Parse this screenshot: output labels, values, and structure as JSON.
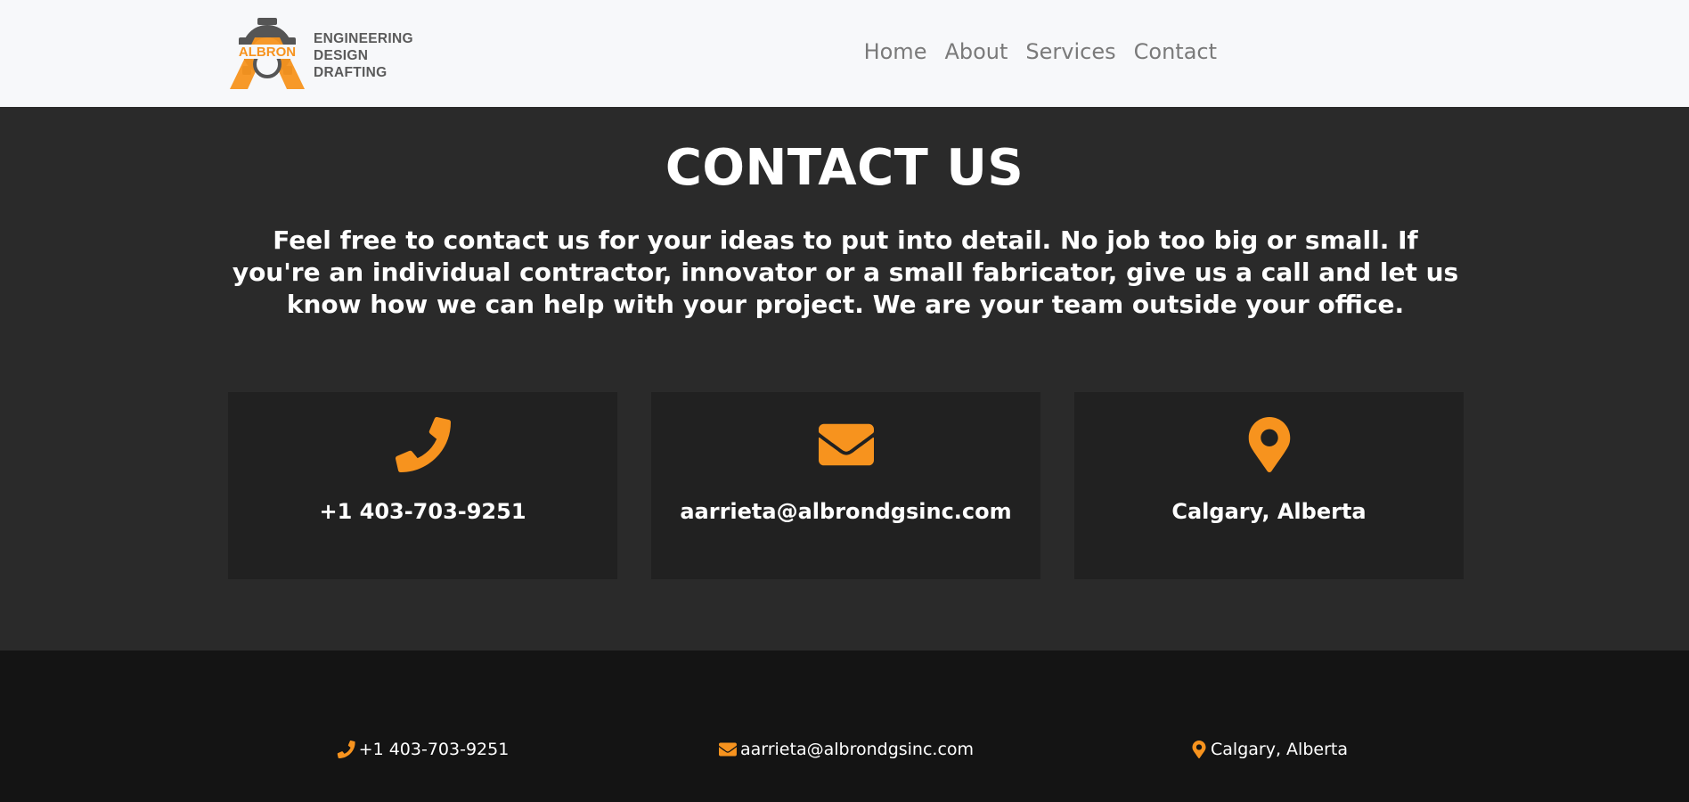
{
  "brand": {
    "logo_text": "ALBRON",
    "tagline_lines": [
      "ENGINEERING",
      "DESIGN",
      "DRAFTING"
    ],
    "accent": "#f7931e"
  },
  "nav": {
    "items": [
      {
        "label": "Home"
      },
      {
        "label": "About"
      },
      {
        "label": "Services"
      },
      {
        "label": "Contact"
      }
    ]
  },
  "contact": {
    "title": "CONTACT US",
    "intro": "Feel free to contact us for your ideas to put into detail. No job too big or small. If you're an individual contractor, innovator or a small fabricator, give us a call and let us know how we can help with your project. We are your team outside your office.",
    "cards": [
      {
        "icon": "phone-icon",
        "value": "+1 403-703-9251"
      },
      {
        "icon": "envelope-icon",
        "value": "aarrieta@albrondgsinc.com"
      },
      {
        "icon": "map-marker-icon",
        "value": "Calgary, Alberta"
      }
    ]
  },
  "footer": {
    "phone": "+1 403-703-9251",
    "email": "aarrieta@albrondgsinc.com",
    "location": "Calgary, Alberta"
  }
}
